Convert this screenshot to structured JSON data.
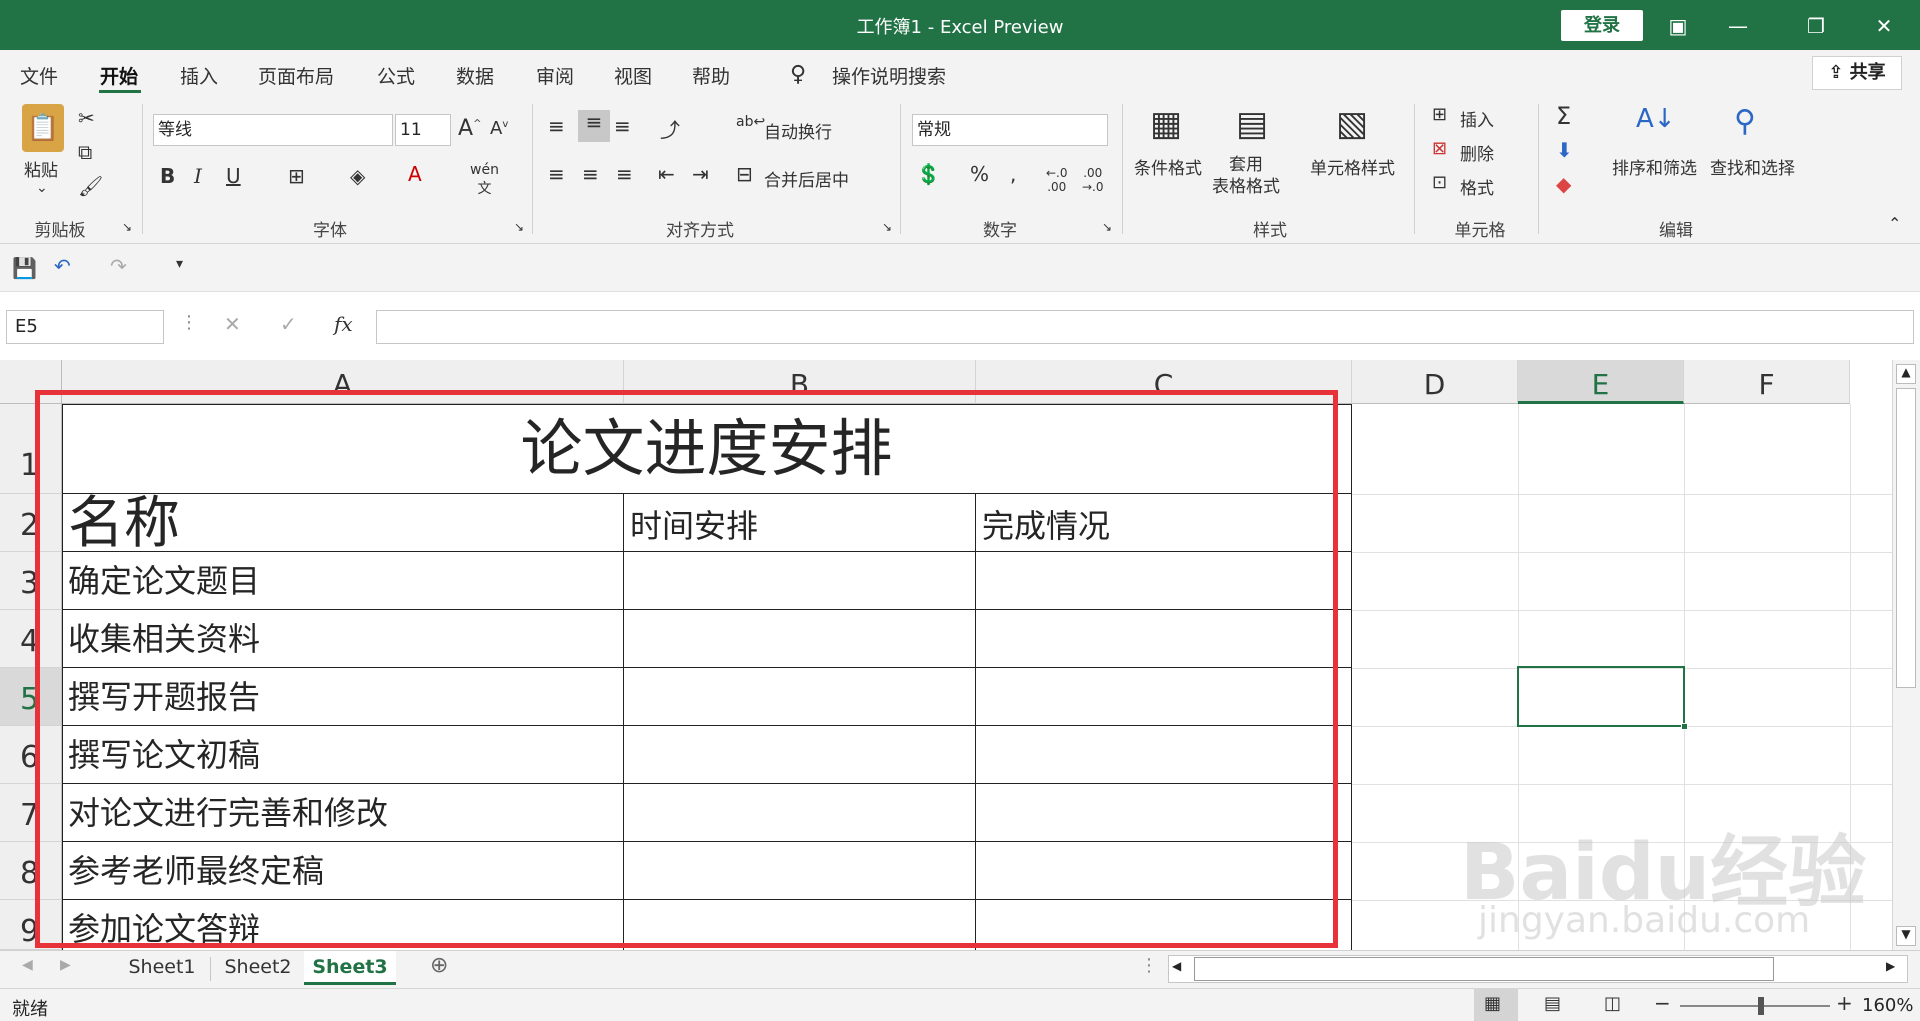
{
  "window": {
    "title": "工作簿1  -  Excel Preview",
    "login_label": "登录"
  },
  "menu": {
    "items": [
      "文件",
      "开始",
      "插入",
      "页面布局",
      "公式",
      "数据",
      "审阅",
      "视图",
      "帮助"
    ],
    "search": "操作说明搜索",
    "share": "共享"
  },
  "ribbon": {
    "paste": "粘贴",
    "font_name": "等线",
    "font_size": "11",
    "wrap": "自动换行",
    "merge": "合并后居中",
    "number_format": "常规",
    "cond_format": "条件格式",
    "table_format": "套用\n表格格式",
    "cell_style": "单元格样式",
    "insert": "插入",
    "delete": "删除",
    "format": "格式",
    "sort": "排序和筛选",
    "find": "查找和选择",
    "groups": [
      "剪贴板",
      "字体",
      "对齐方式",
      "数字",
      "样式",
      "单元格",
      "编辑"
    ]
  },
  "formula": {
    "namebox": "E5",
    "fx": "fx",
    "value": ""
  },
  "columns": [
    "A",
    "B",
    "C",
    "D",
    "E",
    "F"
  ],
  "rows": [
    "1",
    "2",
    "3",
    "4",
    "5",
    "6",
    "7",
    "8",
    "9"
  ],
  "table": {
    "title": "论文进度安排",
    "headers": [
      "名称",
      "时间安排",
      "完成情况"
    ],
    "items": [
      "确定论文题目",
      "收集相关资料",
      "撰写开题报告",
      "撰写论文初稿",
      "对论文进行完善和修改",
      "参考老师最终定稿",
      "参加论文答辩"
    ]
  },
  "sheets": [
    "Sheet1",
    "Sheet2",
    "Sheet3"
  ],
  "status": {
    "ready": "就绪",
    "zoom": "160%"
  },
  "watermark": {
    "brand": "Baidu经验",
    "url": "jingyan.baidu.com"
  },
  "colors": {
    "excel_green": "#217346",
    "highlight_red": "#e8323a"
  }
}
